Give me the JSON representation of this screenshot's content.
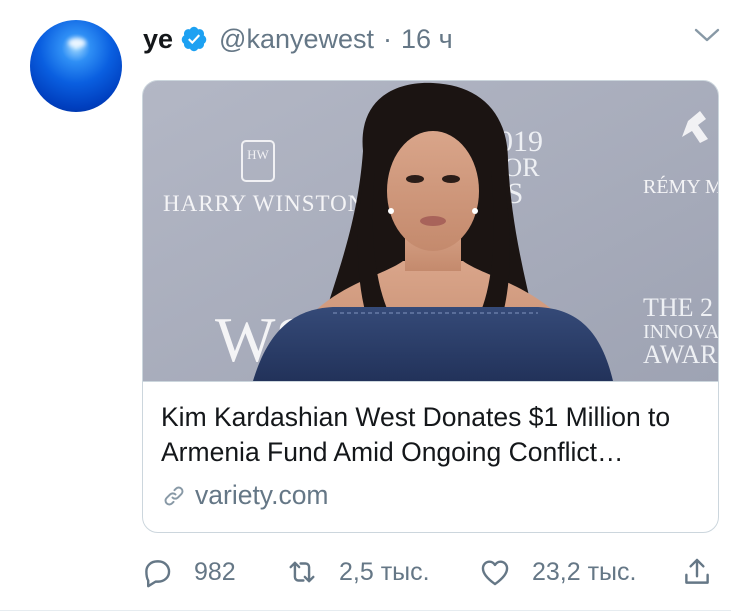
{
  "tweet": {
    "author_name": "ye",
    "author_handle": "@kanyewest",
    "separator": "·",
    "timestamp": "16 ч",
    "verified": true,
    "avatar_icon": "blue-sphere-avatar",
    "menu_icon": "chevron-down-icon"
  },
  "card": {
    "image_description_icon": "article-photo",
    "title": "Kim Kardashian West Donates $1 Million to Armenia Fund Amid Ongoing Conflict…",
    "domain": "variety.com",
    "domain_icon": "link-icon"
  },
  "backdrop_text": {
    "left_brand": "HARRY WINSTON",
    "left_monogram": "HW",
    "center_top": "2019",
    "center_mid": "TOR",
    "center_low": "DS",
    "right_brand": "RÉMY MA",
    "bottom_left": "WS",
    "bottom_right_1": "THE 2",
    "bottom_right_2": "INNOVA",
    "bottom_right_3": "AWAR"
  },
  "actions": {
    "reply_count": "982",
    "retweet_count": "2,5 тыс.",
    "like_count": "23,2 тыс.",
    "reply_icon": "reply-icon",
    "retweet_icon": "retweet-icon",
    "like_icon": "heart-icon",
    "share_icon": "share-icon"
  },
  "colors": {
    "verified_blue": "#1da1f2",
    "secondary_text": "#657786",
    "border": "#ccd6dd"
  }
}
